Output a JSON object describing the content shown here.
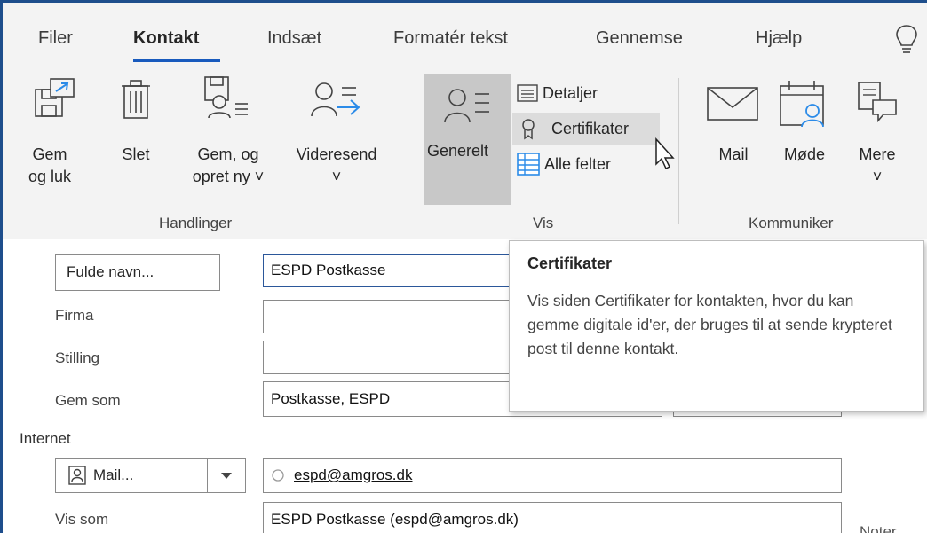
{
  "ribbon": {
    "tabs": [
      "Filer",
      "Kontakt",
      "Indsæt",
      "Formatér tekst",
      "Gennemse",
      "Hjælp"
    ],
    "active_tab": "Kontakt",
    "lightbulb_icon": "lightbulb-icon",
    "handlinger": {
      "group_label": "Handlinger",
      "gem_og_luk_line1": "Gem",
      "gem_og_luk_line2": "og luk",
      "slet": "Slet",
      "gem_og_opret_line1": "Gem, og",
      "gem_og_opret_line2": "opret ny ˅",
      "videresend": "Videresend",
      "videresend_arrow": "˅"
    },
    "vis": {
      "group_label": "Vis",
      "generelt": "Generelt",
      "detaljer": "Detaljer",
      "certifikater": "Certifikater",
      "alle_felter": "Alle felter"
    },
    "kommuniker": {
      "group_label": "Kommuniker",
      "mail": "Mail",
      "mode": "Møde",
      "mere": "Mere",
      "mere_arrow": "˅"
    }
  },
  "form": {
    "fulde_navn_button": "Fulde navn...",
    "fulde_navn_value": "ESPD Postkasse",
    "firma_label": "Firma",
    "firma_value": "",
    "stilling_label": "Stilling",
    "stilling_value": "",
    "gem_som_label": "Gem som",
    "gem_som_value": "Postkasse, ESPD",
    "internet_label": "Internet",
    "mail_button": "Mail...",
    "mail_value": "espd@amgros.dk",
    "vis_som_label": "Vis som",
    "vis_som_value": "ESPD Postkasse (espd@amgros.dk)",
    "noter_label": "Noter"
  },
  "tooltip": {
    "title": "Certifikater",
    "body": "Vis siden Certifikater for kontakten, hvor du kan gemme digitale id'er, der bruges til at sende krypteret post til denne kontakt."
  },
  "colors": {
    "accent": "#185abd",
    "ribbon_bg": "#f3f3f3",
    "selected_bg": "#c8c8c8",
    "icon_blue": "#2b8be8"
  }
}
